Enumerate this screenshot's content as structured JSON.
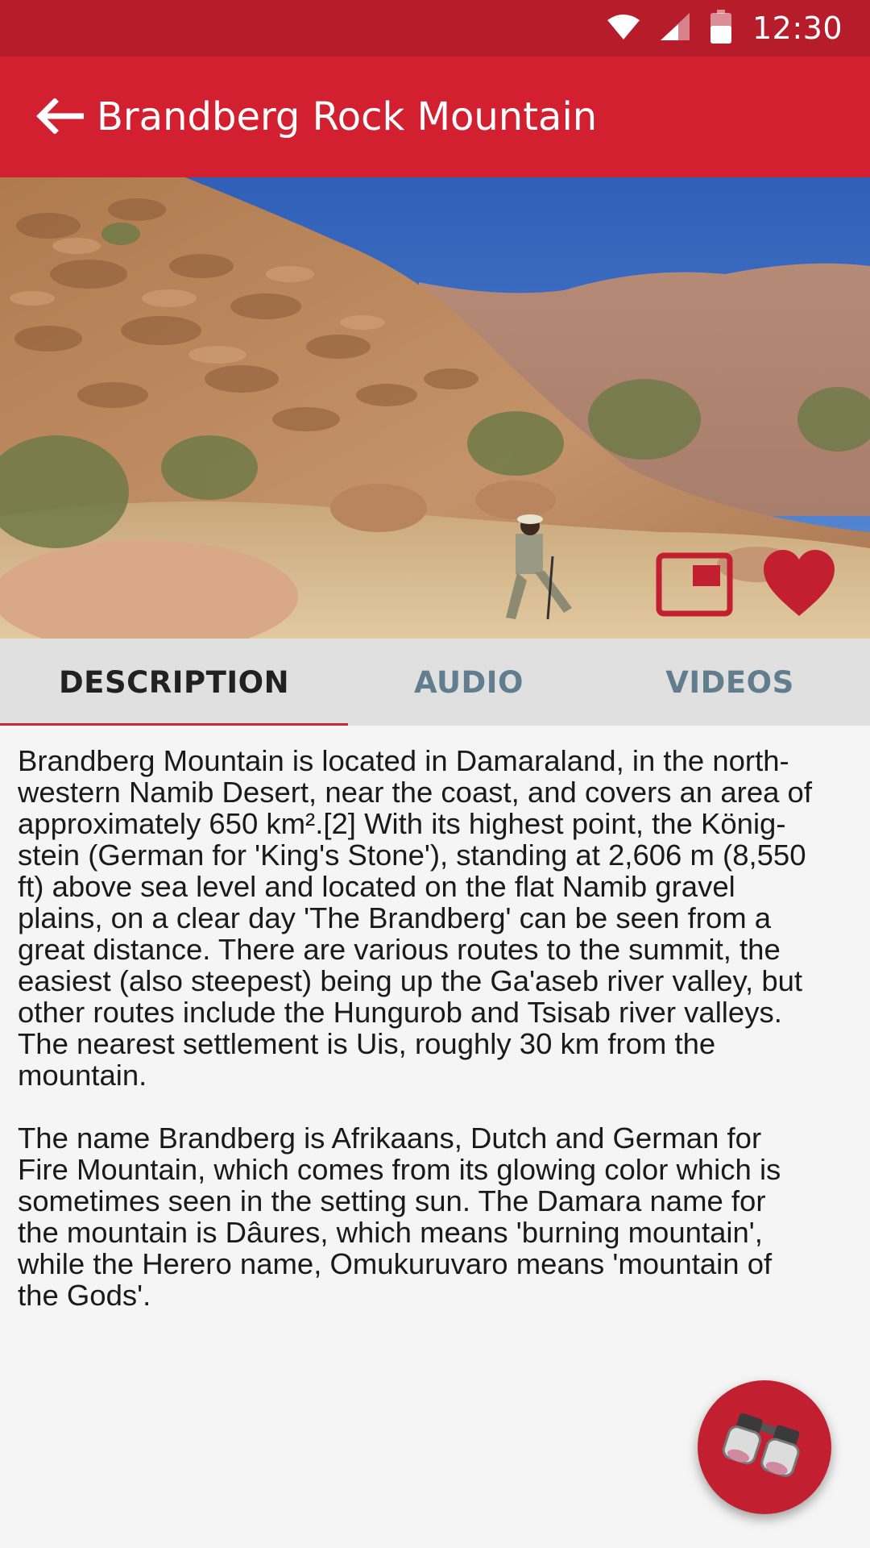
{
  "status_bar": {
    "time": "12:30"
  },
  "app_bar": {
    "title": "Brandberg Rock Mountain",
    "back_icon": "arrow-left-icon"
  },
  "hero": {
    "gallery_icon": "gallery-icon",
    "favorite_icon": "heart-icon",
    "favorite_color": "#c21f30"
  },
  "tabs": [
    {
      "label": "DESCRIPTION",
      "selected": true
    },
    {
      "label": "AUDIO",
      "selected": false
    },
    {
      "label": "VIDEOS",
      "selected": false
    }
  ],
  "description": {
    "paragraphs": [
      "Brandberg Mountain is located in Damaraland, in the north-\nwestern Namib Desert, near the coast, and covers an area of\napproximately 650 km².[2] With its highest point, the König-\nstein (German for 'King's Stone'), standing at 2,606 m (8,550\nft) above sea level and located on the flat Namib gravel\nplains, on a clear day 'The Brandberg' can be seen from a\ngreat distance. There are various routes to the summit, the\neasiest (also steepest) being up the Ga'aseb river valley, but\nother routes include the Hungurob and Tsisab river valleys.\nThe nearest settlement is Uis, roughly 30 km from the\nmountain.",
      "The name Brandberg is Afrikaans, Dutch and German for\nFire Mountain, which comes from its glowing color which is\nsometimes seen in the setting sun. The Damara name for\nthe mountain is Dâures, which means 'burning mountain',\nwhile the Herero name, Omukuruvaro means 'mountain of\nthe Gods'."
    ]
  },
  "fab": {
    "icon": "binoculars-icon"
  },
  "colors": {
    "status_bar": "#b71c2b",
    "app_bar": "#d32030",
    "tab_bar": "#e0e0e0",
    "tab_active_text": "#212121",
    "tab_inactive_text": "#627d8e",
    "tab_indicator": "#c62835",
    "fab": "#c21f30"
  }
}
